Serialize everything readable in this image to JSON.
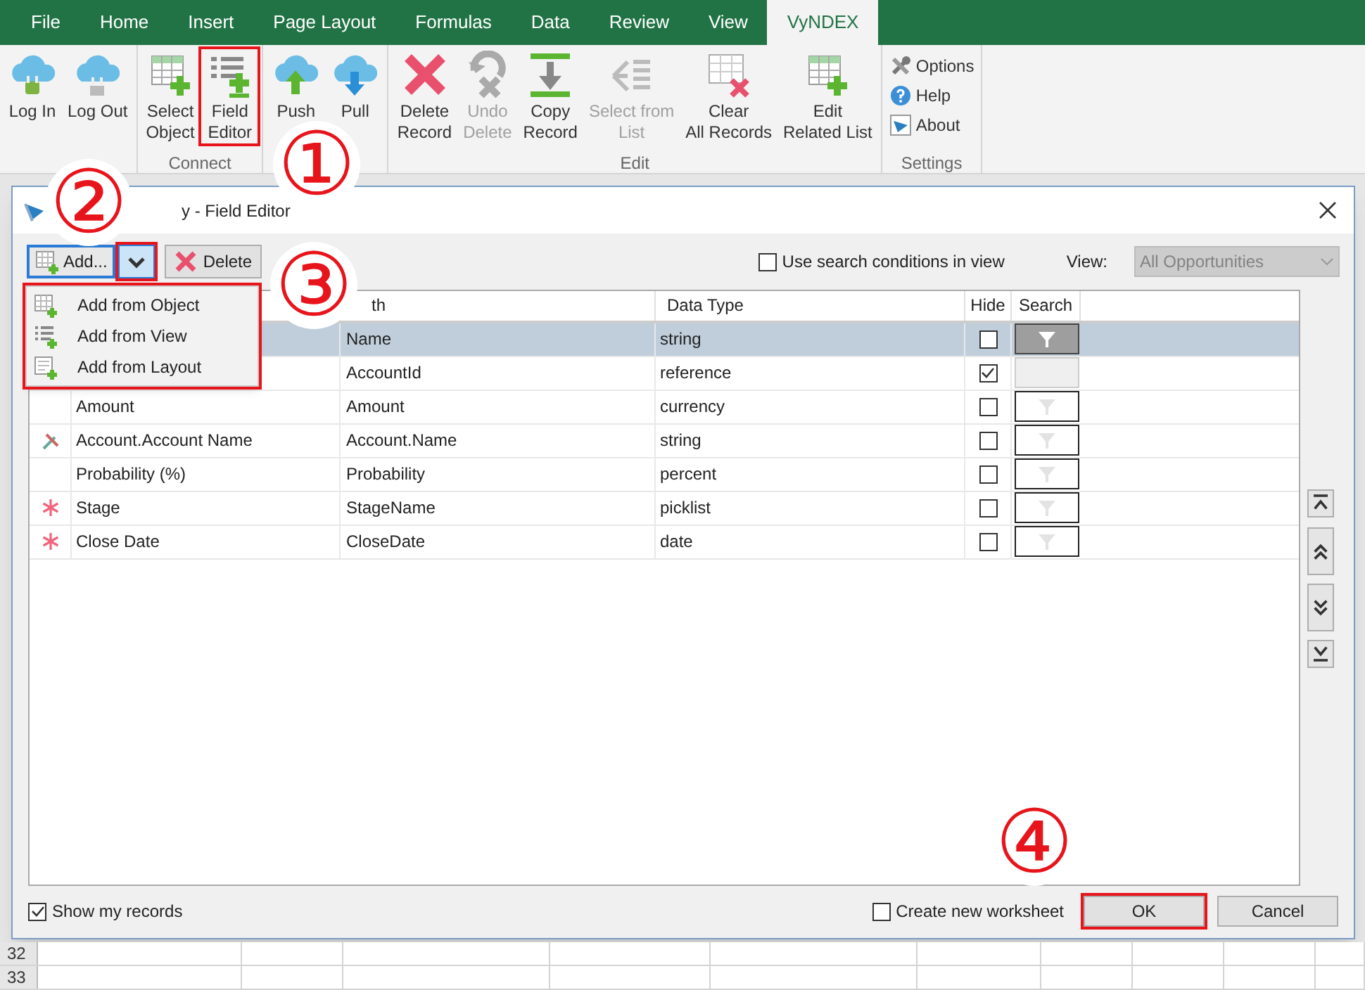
{
  "ribbon_tabs": [
    {
      "label": "File",
      "selected": false
    },
    {
      "label": "Home",
      "selected": false
    },
    {
      "label": "Insert",
      "selected": false
    },
    {
      "label": "Page Layout",
      "selected": false
    },
    {
      "label": "Formulas",
      "selected": false
    },
    {
      "label": "Data",
      "selected": false
    },
    {
      "label": "Review",
      "selected": false
    },
    {
      "label": "View",
      "selected": false
    },
    {
      "label": "VyNDEX",
      "selected": true
    }
  ],
  "ribbon_groups": [
    {
      "buttons": [
        {
          "kind": "login",
          "lines": [
            "Log In"
          ],
          "disabled": false,
          "highlighted": false
        },
        {
          "kind": "logout",
          "lines": [
            "Log Out"
          ],
          "disabled": false,
          "highlighted": false
        }
      ]
    },
    {
      "label": "Connect",
      "buttons": [
        {
          "kind": "select-object",
          "lines": [
            "Select",
            "Object"
          ],
          "disabled": false,
          "highlighted": false
        },
        {
          "kind": "field-editor",
          "lines": [
            "Field",
            "Editor"
          ],
          "disabled": false,
          "highlighted": true
        }
      ]
    },
    {
      "buttons": [
        {
          "kind": "push",
          "lines": [
            "Push"
          ],
          "disabled": false,
          "highlighted": false
        },
        {
          "kind": "pull",
          "lines": [
            "Pull"
          ],
          "disabled": false,
          "highlighted": false
        }
      ]
    },
    {
      "label": "Edit",
      "buttons": [
        {
          "kind": "delete",
          "lines": [
            "Delete",
            "Record"
          ],
          "disabled": false,
          "highlighted": false
        },
        {
          "kind": "undo",
          "lines": [
            "Undo",
            "Delete"
          ],
          "disabled": true,
          "highlighted": false
        },
        {
          "kind": "copy",
          "lines": [
            "Copy",
            "Record"
          ],
          "disabled": false,
          "highlighted": false
        },
        {
          "kind": "select-list",
          "lines": [
            "Select from",
            "List"
          ],
          "disabled": true,
          "highlighted": false
        },
        {
          "kind": "clear",
          "lines": [
            "Clear",
            "All Records"
          ],
          "disabled": false,
          "highlighted": false
        },
        {
          "kind": "related",
          "lines": [
            "Edit",
            "Related List"
          ],
          "disabled": false,
          "highlighted": false
        }
      ]
    },
    {
      "label": "Settings",
      "small_buttons": [
        {
          "kind": "options",
          "label": "Options"
        },
        {
          "kind": "help",
          "label": "Help"
        },
        {
          "kind": "about",
          "label": "About"
        }
      ]
    }
  ],
  "dialog": {
    "title": "y - Field Editor",
    "toolbar": {
      "add_button": "Add...",
      "dropdown": {
        "selected": true,
        "highlighted": true
      },
      "delete_button": "Delete"
    },
    "search_conditions": {
      "label": "Use search conditions in view",
      "checked": false
    },
    "view": {
      "label": "View:",
      "value": "All Opportunities",
      "disabled": true
    },
    "table": {
      "columns": [
        "th",
        "Data Type",
        "Hide",
        "Search"
      ],
      "rows": [
        {
          "path": "Name",
          "data_type": "string",
          "hide": false,
          "search_active": true,
          "search_disabled": false,
          "selected": true
        },
        {
          "path": "AccountId",
          "data_type": "reference",
          "hide": true,
          "search_active": false,
          "search_disabled": true,
          "selected": false
        },
        {
          "required": false,
          "lookup": false,
          "label": "Amount",
          "path": "Amount",
          "data_type": "currency",
          "hide": false,
          "search_active": false,
          "search_disabled": false,
          "selected": false
        },
        {
          "required": false,
          "lookup": true,
          "label": "Account.Account Name",
          "path": "Account.Name",
          "data_type": "string",
          "hide": false,
          "search_active": false,
          "search_disabled": false,
          "selected": false
        },
        {
          "required": false,
          "lookup": false,
          "label": "Probability (%)",
          "path": "Probability",
          "data_type": "percent",
          "hide": false,
          "search_active": false,
          "search_disabled": false,
          "selected": false
        },
        {
          "required": true,
          "lookup": false,
          "label": "Stage",
          "path": "StageName",
          "data_type": "picklist",
          "hide": false,
          "search_active": false,
          "search_disabled": false,
          "selected": false
        },
        {
          "required": true,
          "lookup": false,
          "label": "Close Date",
          "path": "CloseDate",
          "data_type": "date",
          "hide": false,
          "search_active": false,
          "search_disabled": false,
          "selected": false
        }
      ]
    },
    "dropdown_menu": {
      "highlighted": true,
      "items": [
        {
          "kind": "object",
          "label": "Add from Object"
        },
        {
          "kind": "view",
          "label": "Add from View"
        },
        {
          "kind": "layout",
          "label": "Add from Layout"
        }
      ]
    },
    "show_my_records": {
      "label": "Show my records",
      "checked": true
    },
    "create_new_worksheet": {
      "label": "Create new worksheet",
      "checked": false
    },
    "buttons": [
      {
        "label": "OK",
        "highlighted": true
      },
      {
        "label": "Cancel",
        "highlighted": false
      }
    ]
  },
  "sheet_rows": [
    "32",
    "33"
  ],
  "annotations": [
    "①",
    "②",
    "③",
    "④"
  ]
}
